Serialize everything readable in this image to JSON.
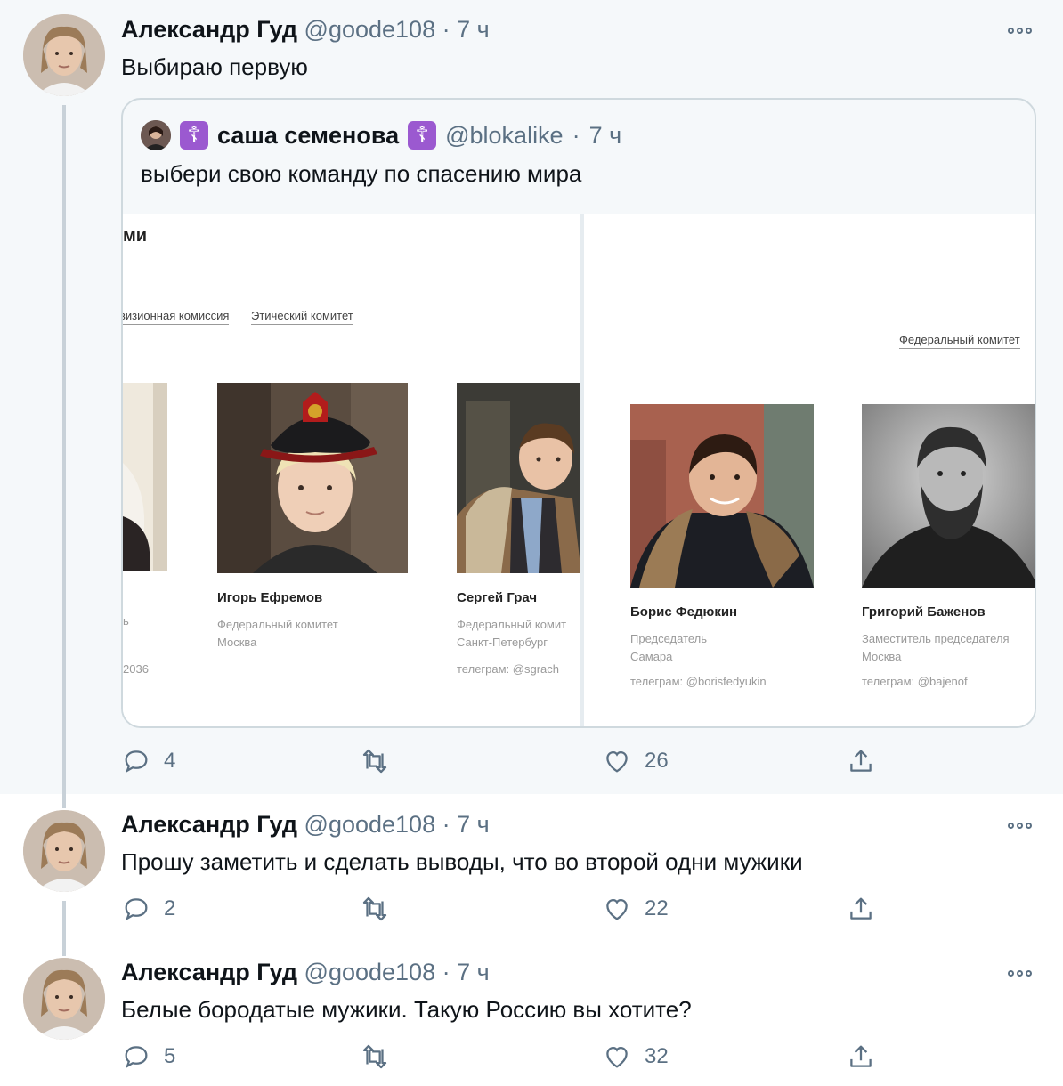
{
  "tweets": [
    {
      "author": "Александр Гуд",
      "handle": "@goode108",
      "dot": "·",
      "time": "7 ч",
      "text": "Выбираю первую",
      "replies": "4",
      "retweets": "",
      "likes": "26"
    },
    {
      "author": "Александр Гуд",
      "handle": "@goode108",
      "dot": "·",
      "time": "7 ч",
      "text": "Прошу заметить и сделать выводы, что во второй одни мужики",
      "replies": "2",
      "retweets": "",
      "likes": "22"
    },
    {
      "author": "Александр Гуд",
      "handle": "@goode108",
      "dot": "·",
      "time": "7 ч",
      "text": "Белые бородатые мужики. Такую Россию вы хотите?",
      "replies": "5",
      "retweets": "",
      "likes": "32"
    }
  ],
  "quote": {
    "cross_icon": "☦",
    "author": "саша семенова",
    "handle": "@blokalike",
    "dot": "·",
    "time": "7 ч",
    "text": "выбери свою команду по спасению мира",
    "left_panel": {
      "title": "ми",
      "tab_1": "визионная комиссия",
      "tab_2": "Этический комитет",
      "persons": [
        {
          "name": "",
          "line1": "ь",
          "line2": "",
          "tg": "2036"
        },
        {
          "name": "Игорь Ефремов",
          "line1": "Федеральный комитет",
          "line2": "Москва",
          "tg": ""
        },
        {
          "name": "Сергей Грач",
          "line1": "Федеральный комит",
          "line2": "Санкт-Петербург",
          "tg": "телеграм: @sgrach"
        }
      ]
    },
    "right_panel": {
      "tab": "Федеральный комитет",
      "persons": [
        {
          "name": "Борис Федюкин",
          "line1": "Председатель",
          "line2": "Самара",
          "tg": "телеграм: @borisfedyukin"
        },
        {
          "name": "Григорий Баженов",
          "line1": "Заместитель председателя",
          "line2": "Москва",
          "tg": "телеграм: @bajenof"
        }
      ]
    }
  },
  "colors": {
    "accent_purple": "#9b59d0",
    "muted": "#5b7083",
    "thread_line": "#c8d1d8"
  },
  "icons": [
    "reply-icon",
    "retweet-icon",
    "like-icon",
    "share-icon",
    "more-icon",
    "orthodox-cross-icon"
  ]
}
